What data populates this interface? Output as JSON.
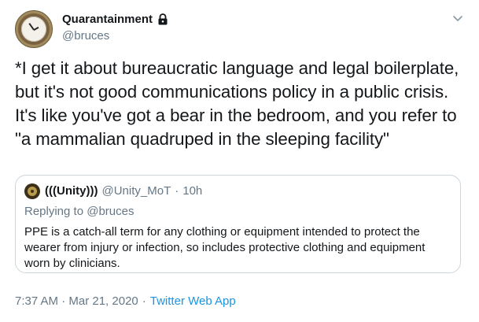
{
  "author": {
    "display_name": "Quarantainment",
    "handle": "@bruces",
    "protected_icon": "lock-icon",
    "avatar_icon": "clock-avatar"
  },
  "menu": {
    "icon": "chevron-down-icon"
  },
  "tweet": {
    "text": "*I get it about bureaucratic language and legal boilerplate, but it's not good communications policy in a public crisis. It's like you've got a bear in the bedroom, and you refer to \"a mammalian quadruped in the sleeping facility\""
  },
  "quoted_tweet": {
    "display_name": "(((Unity)))",
    "handle": "@Unity_MoT",
    "separator": "·",
    "time": "10h",
    "replying_to": "Replying to @bruces",
    "text": "PPE is a catch-all term for any clothing or equipment intended to protect the wearer from injury or infection, so includes protective clothing and equipment worn by clinicians."
  },
  "footer": {
    "timestamp": "7:37 AM · Mar 21, 2020",
    "separator": "·",
    "source": "Twitter Web App"
  },
  "colors": {
    "text": "#14171a",
    "secondary": "#657786",
    "link": "#1b95e0",
    "border": "#ccd6dd"
  }
}
